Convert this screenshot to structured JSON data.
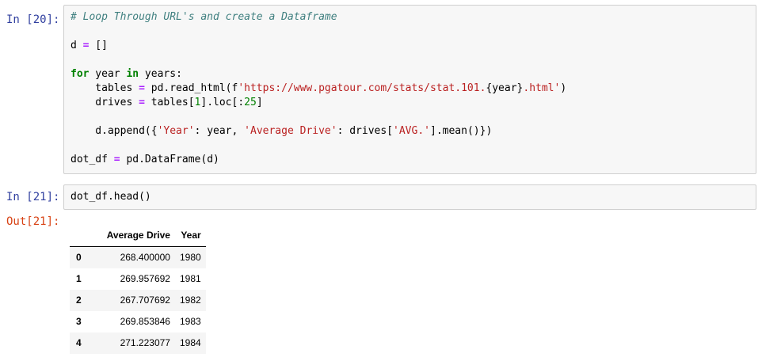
{
  "cells": [
    {
      "prompt": "In [20]:",
      "code": {
        "comment": "# Loop Through URL's and create a Dataframe",
        "line_d_var": "d",
        "line_d_rest": " [] ",
        "for_kw": "for",
        "for_var": " year ",
        "in_kw": "in",
        "for_iter": " years:",
        "tables_lhs": "    tables ",
        "tables_call": " pd.read_html(f",
        "tables_url": "'https://www.pgatour.com/stats/stat.101.",
        "tables_year": "{year}",
        "tables_url_end": ".html'",
        "tables_close": ")",
        "drives_lhs": "    drives ",
        "drives_call": " tables[",
        "drives_idx": "1",
        "drives_mid": "].loc[:",
        "drives_end_num": "25",
        "drives_close": "]",
        "append_open": "    d.append({",
        "append_key1": "'Year'",
        "append_mid1": ": year, ",
        "append_key2": "'Average Drive'",
        "append_mid2": ": drives[",
        "append_key3": "'AVG.'",
        "append_close": "].mean()})",
        "dot_lhs": "dot_df ",
        "dot_rhs": " pd.DataFrame(d)"
      }
    },
    {
      "prompt": "In [21]:",
      "code": "dot_df.head()"
    }
  ],
  "output": {
    "prompt": "Out[21]:",
    "table": {
      "columns": [
        "Average Drive",
        "Year"
      ],
      "rows": [
        {
          "index": "0",
          "Average Drive": "268.400000",
          "Year": "1980"
        },
        {
          "index": "1",
          "Average Drive": "269.957692",
          "Year": "1981"
        },
        {
          "index": "2",
          "Average Drive": "267.707692",
          "Year": "1982"
        },
        {
          "index": "3",
          "Average Drive": "269.853846",
          "Year": "1983"
        },
        {
          "index": "4",
          "Average Drive": "271.223077",
          "Year": "1984"
        }
      ]
    }
  }
}
